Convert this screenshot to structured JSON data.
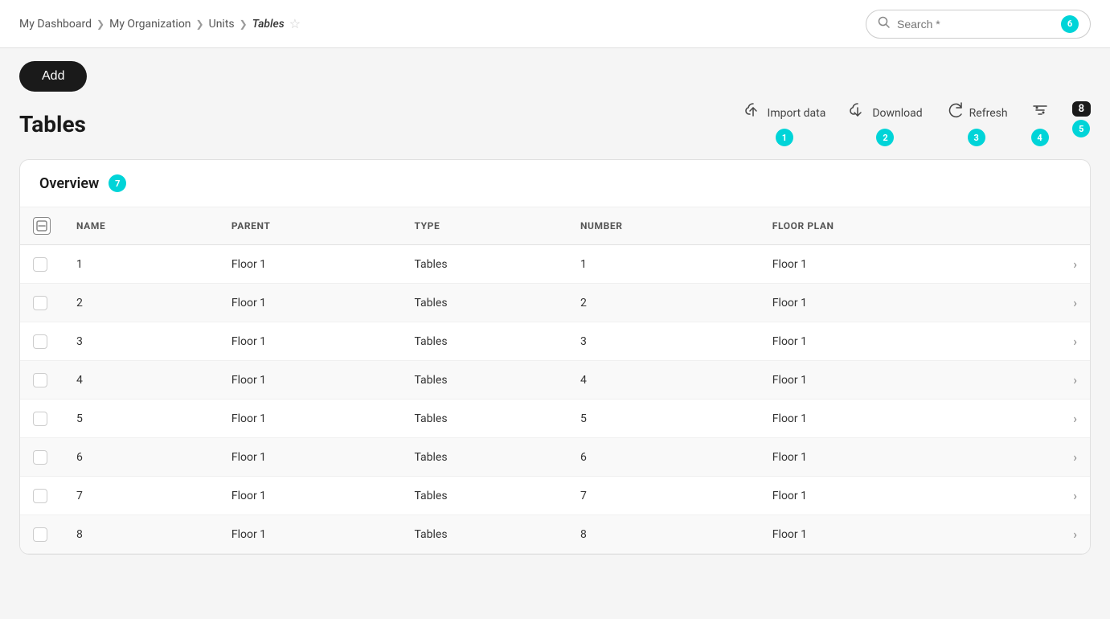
{
  "breadcrumb": {
    "items": [
      {
        "label": "My Dashboard",
        "active": false
      },
      {
        "label": "My Organization",
        "active": false
      },
      {
        "label": "Units",
        "active": false
      },
      {
        "label": "Tables",
        "active": true
      }
    ]
  },
  "header": {
    "add_button_label": "Add",
    "search_placeholder": "Search *",
    "search_badge": "6"
  },
  "page": {
    "title": "Tables"
  },
  "toolbar": {
    "import_label": "Import data",
    "import_badge": "1",
    "download_label": "Download",
    "download_badge": "2",
    "refresh_label": "Refresh",
    "refresh_badge": "3",
    "filter_badge": "4",
    "count_badge": "8",
    "count_sub_badge": "5"
  },
  "overview": {
    "title": "Overview",
    "badge": "7"
  },
  "table": {
    "columns": [
      "NAME",
      "PARENT",
      "TYPE",
      "NUMBER",
      "FLOOR PLAN"
    ],
    "rows": [
      {
        "name": "1",
        "parent": "Floor 1",
        "type": "Tables",
        "number": "1",
        "floor_plan": "Floor 1"
      },
      {
        "name": "2",
        "parent": "Floor 1",
        "type": "Tables",
        "number": "2",
        "floor_plan": "Floor 1"
      },
      {
        "name": "3",
        "parent": "Floor 1",
        "type": "Tables",
        "number": "3",
        "floor_plan": "Floor 1"
      },
      {
        "name": "4",
        "parent": "Floor 1",
        "type": "Tables",
        "number": "4",
        "floor_plan": "Floor 1"
      },
      {
        "name": "5",
        "parent": "Floor 1",
        "type": "Tables",
        "number": "5",
        "floor_plan": "Floor 1"
      },
      {
        "name": "6",
        "parent": "Floor 1",
        "type": "Tables",
        "number": "6",
        "floor_plan": "Floor 1"
      },
      {
        "name": "7",
        "parent": "Floor 1",
        "type": "Tables",
        "number": "7",
        "floor_plan": "Floor 1"
      },
      {
        "name": "8",
        "parent": "Floor 1",
        "type": "Tables",
        "number": "8",
        "floor_plan": "Floor 1"
      }
    ]
  },
  "icons": {
    "search": "&#x1F50D;",
    "star": "&#9733;",
    "chevron_right": "&#8250;",
    "import": "&#x2601;&#xFE0F;",
    "download": "&#x2193;",
    "refresh": "&#x21BB;",
    "filter": "&#x2261;"
  }
}
